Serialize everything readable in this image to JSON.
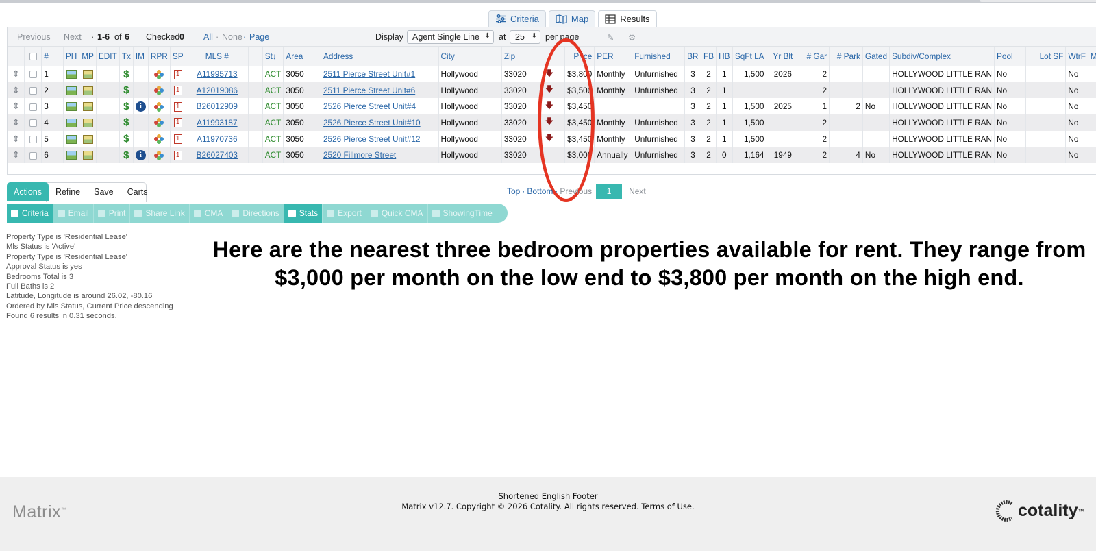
{
  "view_tabs": [
    {
      "label": "Criteria",
      "icon": "sliders-icon"
    },
    {
      "label": "Map",
      "icon": "map-icon"
    },
    {
      "label": "Results",
      "icon": "table-icon"
    }
  ],
  "toolbar": {
    "previous": "Previous",
    "next": "Next",
    "range_prefix": "·",
    "range": "1-6",
    "of_label": "of",
    "total": "6",
    "checked_label": "Checked",
    "checked_count": "0",
    "all": "All",
    "none": "None",
    "page": "Page",
    "sep": "·",
    "display_label": "Display",
    "display_value": "Agent Single Line",
    "at_label": "at",
    "per_page_value": "25",
    "per_page_label": "per page"
  },
  "columns": [
    "#",
    "PH",
    "MP",
    "EDIT",
    "Tx",
    "IM",
    "RPR",
    "SP",
    "MLS #",
    "St",
    "Area",
    "Address",
    "City",
    "Zip",
    "",
    "Price",
    "PER",
    "Furnished",
    "BR",
    "FB",
    "HB",
    "SqFt LA",
    "Yr Blt",
    "# Gar",
    "# Park",
    "Gated",
    "Subdiv/Complex",
    "Pool",
    "Lot SF",
    "WtrF",
    "M"
  ],
  "rows": [
    {
      "num": "1",
      "mls": "A11995713",
      "st": "ACT",
      "area": "3050",
      "address": "2511 Pierce Street Unit#1",
      "city": "Hollywood",
      "zip": "33020",
      "price": "$3,800",
      "per": "Monthly",
      "furnished": "Unfurnished",
      "br": "3",
      "fb": "2",
      "hb": "1",
      "sqft": "1,500",
      "yr": "2026",
      "gar": "2",
      "park": "",
      "gated": "",
      "subdiv": "HOLLYWOOD LITTLE RAN",
      "pool": "No",
      "lot": "",
      "wtrf": "No",
      "has_info": false
    },
    {
      "num": "2",
      "mls": "A12019086",
      "st": "ACT",
      "area": "3050",
      "address": "2511 Pierce Street Unit#6",
      "city": "Hollywood",
      "zip": "33020",
      "price": "$3,500",
      "per": "Monthly",
      "furnished": "Unfurnished",
      "br": "3",
      "fb": "2",
      "hb": "1",
      "sqft": "",
      "yr": "",
      "gar": "2",
      "park": "",
      "gated": "",
      "subdiv": "HOLLYWOOD LITTLE RAN",
      "pool": "No",
      "lot": "",
      "wtrf": "No",
      "has_info": false
    },
    {
      "num": "3",
      "mls": "B26012909",
      "st": "ACT",
      "area": "3050",
      "address": "2526 Pierce Street Unit#4",
      "city": "Hollywood",
      "zip": "33020",
      "price": "$3,450",
      "per": "",
      "furnished": "",
      "br": "3",
      "fb": "2",
      "hb": "1",
      "sqft": "1,500",
      "yr": "2025",
      "gar": "1",
      "park": "2",
      "gated": "No",
      "subdiv": "HOLLYWOOD LITTLE RAN",
      "pool": "No",
      "lot": "",
      "wtrf": "No",
      "has_info": true
    },
    {
      "num": "4",
      "mls": "A11993187",
      "st": "ACT",
      "area": "3050",
      "address": "2526 Pierce Street Unit#10",
      "city": "Hollywood",
      "zip": "33020",
      "price": "$3,450",
      "per": "Monthly",
      "furnished": "Unfurnished",
      "br": "3",
      "fb": "2",
      "hb": "1",
      "sqft": "1,500",
      "yr": "",
      "gar": "2",
      "park": "",
      "gated": "",
      "subdiv": "HOLLYWOOD LITTLE RAN",
      "pool": "No",
      "lot": "",
      "wtrf": "No",
      "has_info": false
    },
    {
      "num": "5",
      "mls": "A11970736",
      "st": "ACT",
      "area": "3050",
      "address": "2526 Pierce Street Unit#12",
      "city": "Hollywood",
      "zip": "33020",
      "price": "$3,450",
      "per": "Monthly",
      "furnished": "Unfurnished",
      "br": "3",
      "fb": "2",
      "hb": "1",
      "sqft": "1,500",
      "yr": "",
      "gar": "2",
      "park": "",
      "gated": "",
      "subdiv": "HOLLYWOOD LITTLE RAN",
      "pool": "No",
      "lot": "",
      "wtrf": "No",
      "has_info": false
    },
    {
      "num": "6",
      "mls": "B26027403",
      "st": "ACT",
      "area": "3050",
      "address": "2520 Fillmore Street",
      "city": "Hollywood",
      "zip": "33020",
      "price": "$3,000",
      "per": "Annually",
      "furnished": "Unfurnished",
      "br": "3",
      "fb": "2",
      "hb": "0",
      "sqft": "1,164",
      "yr": "1949",
      "gar": "2",
      "park": "4",
      "gated": "No",
      "subdiv": "HOLLYWOOD LITTLE RAN",
      "pool": "No",
      "lot": "",
      "wtrf": "No",
      "has_info": true
    }
  ],
  "pager": {
    "top": "Top",
    "bottom": "Bottom",
    "previous": "Previous",
    "page": "1",
    "next": "Next",
    "sep": "·"
  },
  "action_tabs": [
    "Actions",
    "Refine",
    "Save",
    "Carts"
  ],
  "actions": [
    {
      "label": "Criteria",
      "on": true
    },
    {
      "label": "Email",
      "on": false
    },
    {
      "label": "Print",
      "on": false
    },
    {
      "label": "Share Link",
      "on": false
    },
    {
      "label": "CMA",
      "on": false
    },
    {
      "label": "Directions",
      "on": false
    },
    {
      "label": "Stats",
      "on": true
    },
    {
      "label": "Export",
      "on": false
    },
    {
      "label": "Quick CMA",
      "on": false
    },
    {
      "label": "ShowingTime",
      "on": false
    }
  ],
  "criteria": [
    "Property Type is 'Residential Lease'",
    "Mls Status is 'Active'",
    "Property Type is 'Residential Lease'",
    "Approval Status is yes",
    "Bedrooms Total is 3",
    "Full Baths is 2",
    "Latitude, Longitude is around 26.02, -80.16",
    "Ordered by Mls Status, Current Price descending",
    "Found 6 results in 0.31 seconds."
  ],
  "caption": "Here are the nearest three bedroom properties available for rent. They range from $3,000 per month on the low end to $3,800 per month on the high end.",
  "footer": {
    "matrix_logo": "Matrix",
    "tm": "™",
    "line1": "Shortened English Footer",
    "line2": "Matrix v12.7. Copyright © 2026 Cotality. All rights reserved. Terms of Use.",
    "cotality_logo": "cotality",
    "cotality_tm": "™"
  },
  "colors": {
    "accent": "#38b8b0",
    "link": "#2a67a8",
    "highlight_oval": "#e53422",
    "status_active": "#2e8b2e"
  }
}
